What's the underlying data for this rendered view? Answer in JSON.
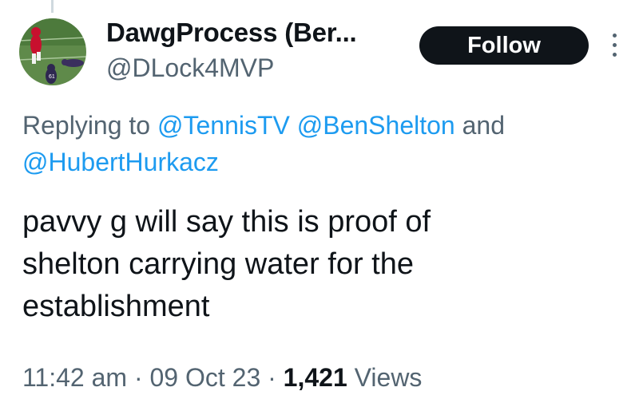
{
  "author": {
    "display_name": "DawgProcess (Ber...",
    "handle": "@DLock4MVP",
    "avatar_icon": "football-photo-avatar"
  },
  "follow_label": "Follow",
  "more_icon": "more-vertical-icon",
  "reply": {
    "prefix": "Replying to",
    "mentions": [
      "@TennisTV",
      "@BenShelton",
      "@HubertHurkacz"
    ],
    "conjunction": "and"
  },
  "tweet": {
    "lines": [
      "pavvy g will say this is proof of",
      "shelton carrying water for the",
      "establishment"
    ]
  },
  "meta": {
    "time": "11:42 am",
    "separator": "·",
    "date": "09 Oct 23",
    "views_count": "1,421",
    "views_label": "Views"
  },
  "colors": {
    "text": "#0f1419",
    "secondary": "#536471",
    "link": "#1d9bf0",
    "button_bg": "#0f1419"
  }
}
